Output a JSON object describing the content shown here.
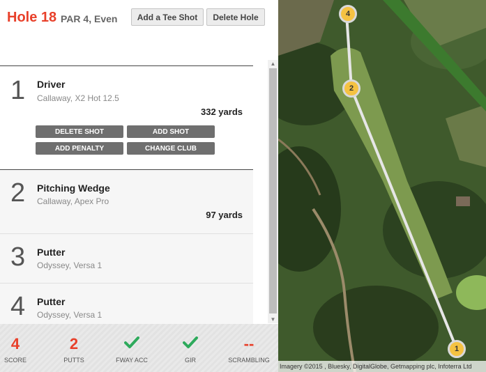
{
  "header": {
    "hole_title": "Hole 18",
    "hole_sub": "PAR 4, Even",
    "add_tee_shot": "Add a Tee Shot",
    "delete_hole": "Delete Hole"
  },
  "shots": [
    {
      "num": "1",
      "club": "Driver",
      "model": "Callaway, X2 Hot 12.5",
      "distance": "332 yards"
    },
    {
      "num": "2",
      "club": "Pitching Wedge",
      "model": "Callaway, Apex Pro",
      "distance": "97 yards"
    },
    {
      "num": "3",
      "club": "Putter",
      "model": "Odyssey, Versa 1",
      "distance": ""
    },
    {
      "num": "4",
      "club": "Putter",
      "model": "Odyssey, Versa 1",
      "distance": ""
    }
  ],
  "shot_actions": {
    "delete_shot": "DELETE SHOT",
    "add_shot": "ADD SHOT",
    "add_penalty": "ADD PENALTY",
    "change_club": "CHANGE CLUB"
  },
  "stats": [
    {
      "value": "4",
      "label": "SCORE",
      "icon": ""
    },
    {
      "value": "2",
      "label": "PUTTS",
      "icon": ""
    },
    {
      "value": "",
      "label": "FWAY ACC",
      "icon": "check-icon"
    },
    {
      "value": "",
      "label": "GIR",
      "icon": "check-icon"
    },
    {
      "value": "--",
      "label": "SCRAMBLING",
      "icon": ""
    }
  ],
  "map": {
    "markers": [
      "4",
      "2",
      "1"
    ],
    "credit": "Imagery ©2015 , Bluesky, DigitalGlobe, Getmapping plc, Infoterra Ltd"
  },
  "colors": {
    "accent": "#e8402a",
    "check": "#2eaa5c",
    "marker": "#f5c242"
  }
}
